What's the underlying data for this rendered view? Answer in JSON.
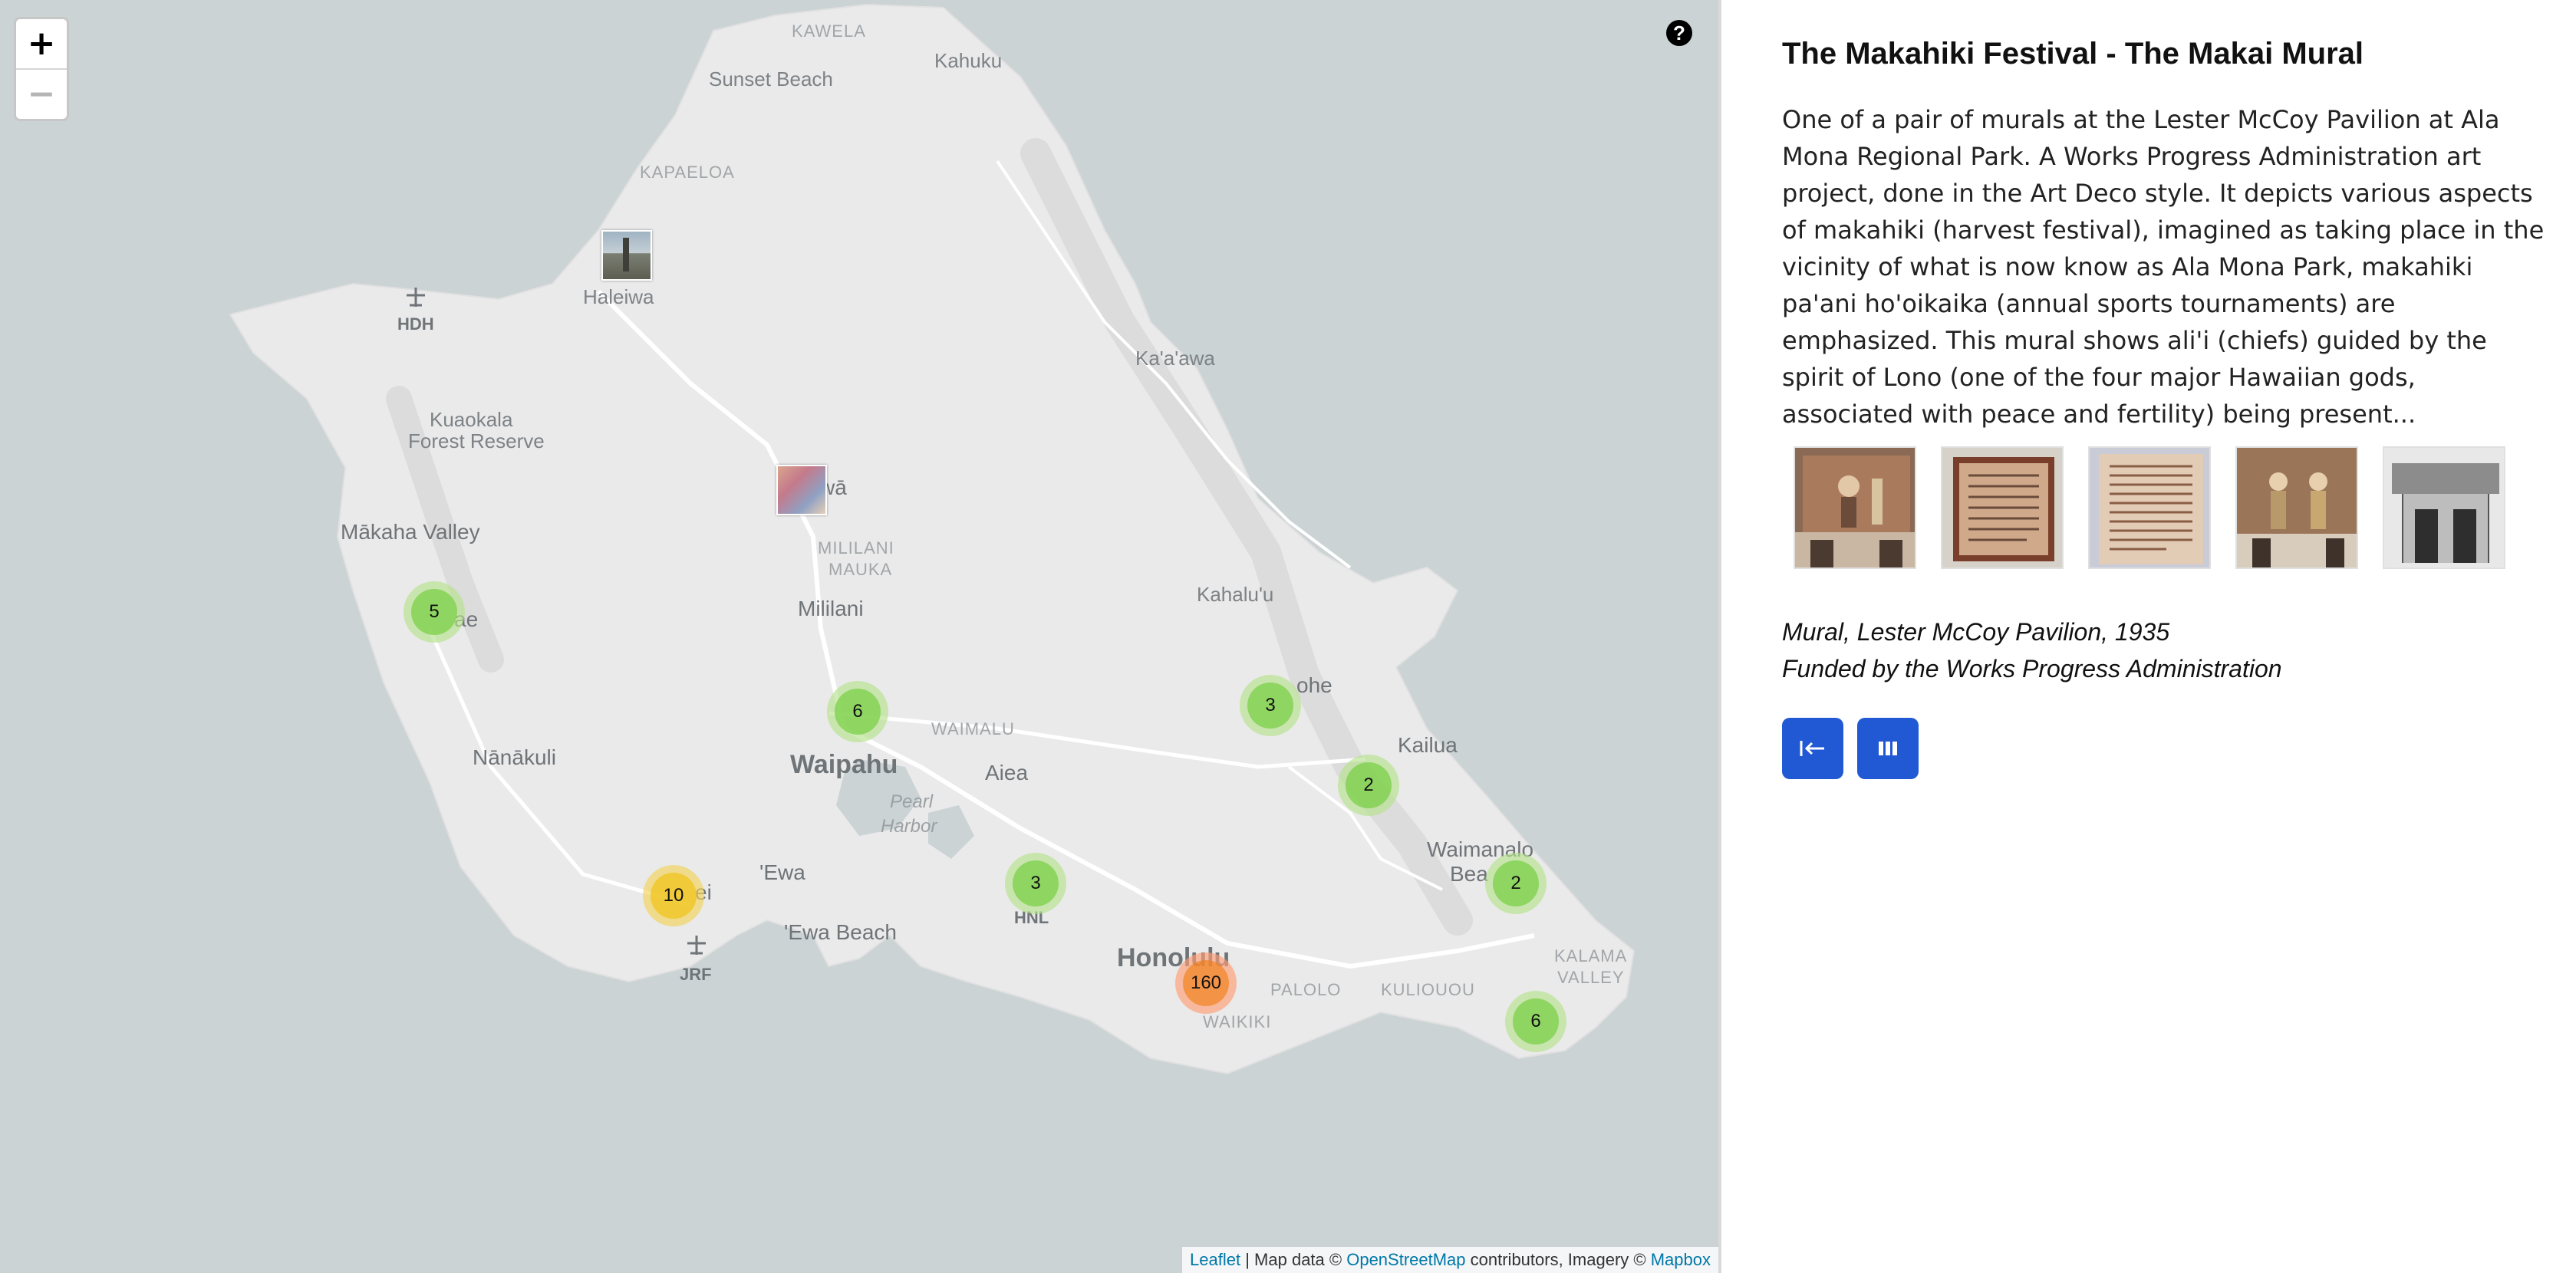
{
  "map": {
    "zoom_in_label": "+",
    "zoom_out_label": "−",
    "help_label": "?",
    "labels": {
      "kawela": "KAWELA",
      "kahuku": "Kahuku",
      "sunset_beach": "Sunset Beach",
      "kapaeloa": "KAPAELOA",
      "haleiwa": "Haleiwa",
      "hdh": "HDH",
      "kaawa": "Ka'a'awa",
      "kuaokala": "Kuaokala",
      "forest_reserve": "Forest Reserve",
      "wahiawa": "wā",
      "makaha_valley": "Mākaha Valley",
      "mililani_mauka_1": "MILILANI",
      "mililani_mauka_2": "MAUKA",
      "mililani": "Mililani",
      "kahaluu": "Kahalu'u",
      "waianae": "ae",
      "kaneohe": "ohe",
      "waimalu": "WAIMALU",
      "nanakuli": "Nānākuli",
      "waipahu": "Waipahu",
      "aiea": "Aiea",
      "kailua": "Kailua",
      "pearl_1": "Pearl",
      "pearl_2": "Harbor",
      "kapolei": "ei",
      "ewa": "'Ewa",
      "ewa_beach": "'Ewa Beach",
      "hnl": "HNL",
      "waimanalo": "Waimanalo",
      "waimanalo_beach": "Bea",
      "honolulu": "Honolulu",
      "jrf": "JRF",
      "palolo": "PALOLO",
      "kuliouou": "KULIOUOU",
      "kalama_1": "KALAMA",
      "kalama_2": "VALLEY",
      "waikiki": "WAIKIKI"
    },
    "clusters": [
      {
        "count": "5",
        "size": "small"
      },
      {
        "count": "6",
        "size": "small"
      },
      {
        "count": "3",
        "size": "small"
      },
      {
        "count": "2",
        "size": "small"
      },
      {
        "count": "10",
        "size": "medium"
      },
      {
        "count": "3",
        "size": "small"
      },
      {
        "count": "160",
        "size": "large"
      },
      {
        "count": "2",
        "size": "small"
      },
      {
        "count": "6",
        "size": "small"
      }
    ],
    "attribution": {
      "leaflet": "Leaflet",
      "sep1": " | Map data © ",
      "osm": "OpenStreetMap",
      "sep2": " contributors, Imagery © ",
      "mapbox": "Mapbox"
    }
  },
  "panel": {
    "title": "The Makahiki Festival - The Makai Mural",
    "description": "One of a pair of murals at the Lester McCoy Pavilion at Ala Mona Regional Park. A Works Progress Administration art project, done in the Art Deco style. It depicts various aspects of makahiki (harvest festival), imagined as taking place in the vicinity of what is now know as Ala Mona Park, makahiki pa'ani ho'oikaika (annual sports tournaments) are emphasized. This mural shows ali'i (chiefs) guided by the spirit of Lono (one of the four major Hawaiian gods, associated with peace and fertility) being present...",
    "caption_line1": "Mural, Lester McCoy Pavilion, 1935",
    "caption_line2": "Funded by the Works Progress Administration",
    "thumbnails": [
      "mural-photo",
      "plaque-photo",
      "plaque-text-photo",
      "mural-detail-photo",
      "bw-photo"
    ],
    "buttons": [
      "back-to-start-icon",
      "gallery-icon"
    ]
  },
  "colors": {
    "sea": "#cbd3d5",
    "land": "#eaeaea",
    "button_blue": "#2158d4",
    "link": "#0078a8"
  }
}
